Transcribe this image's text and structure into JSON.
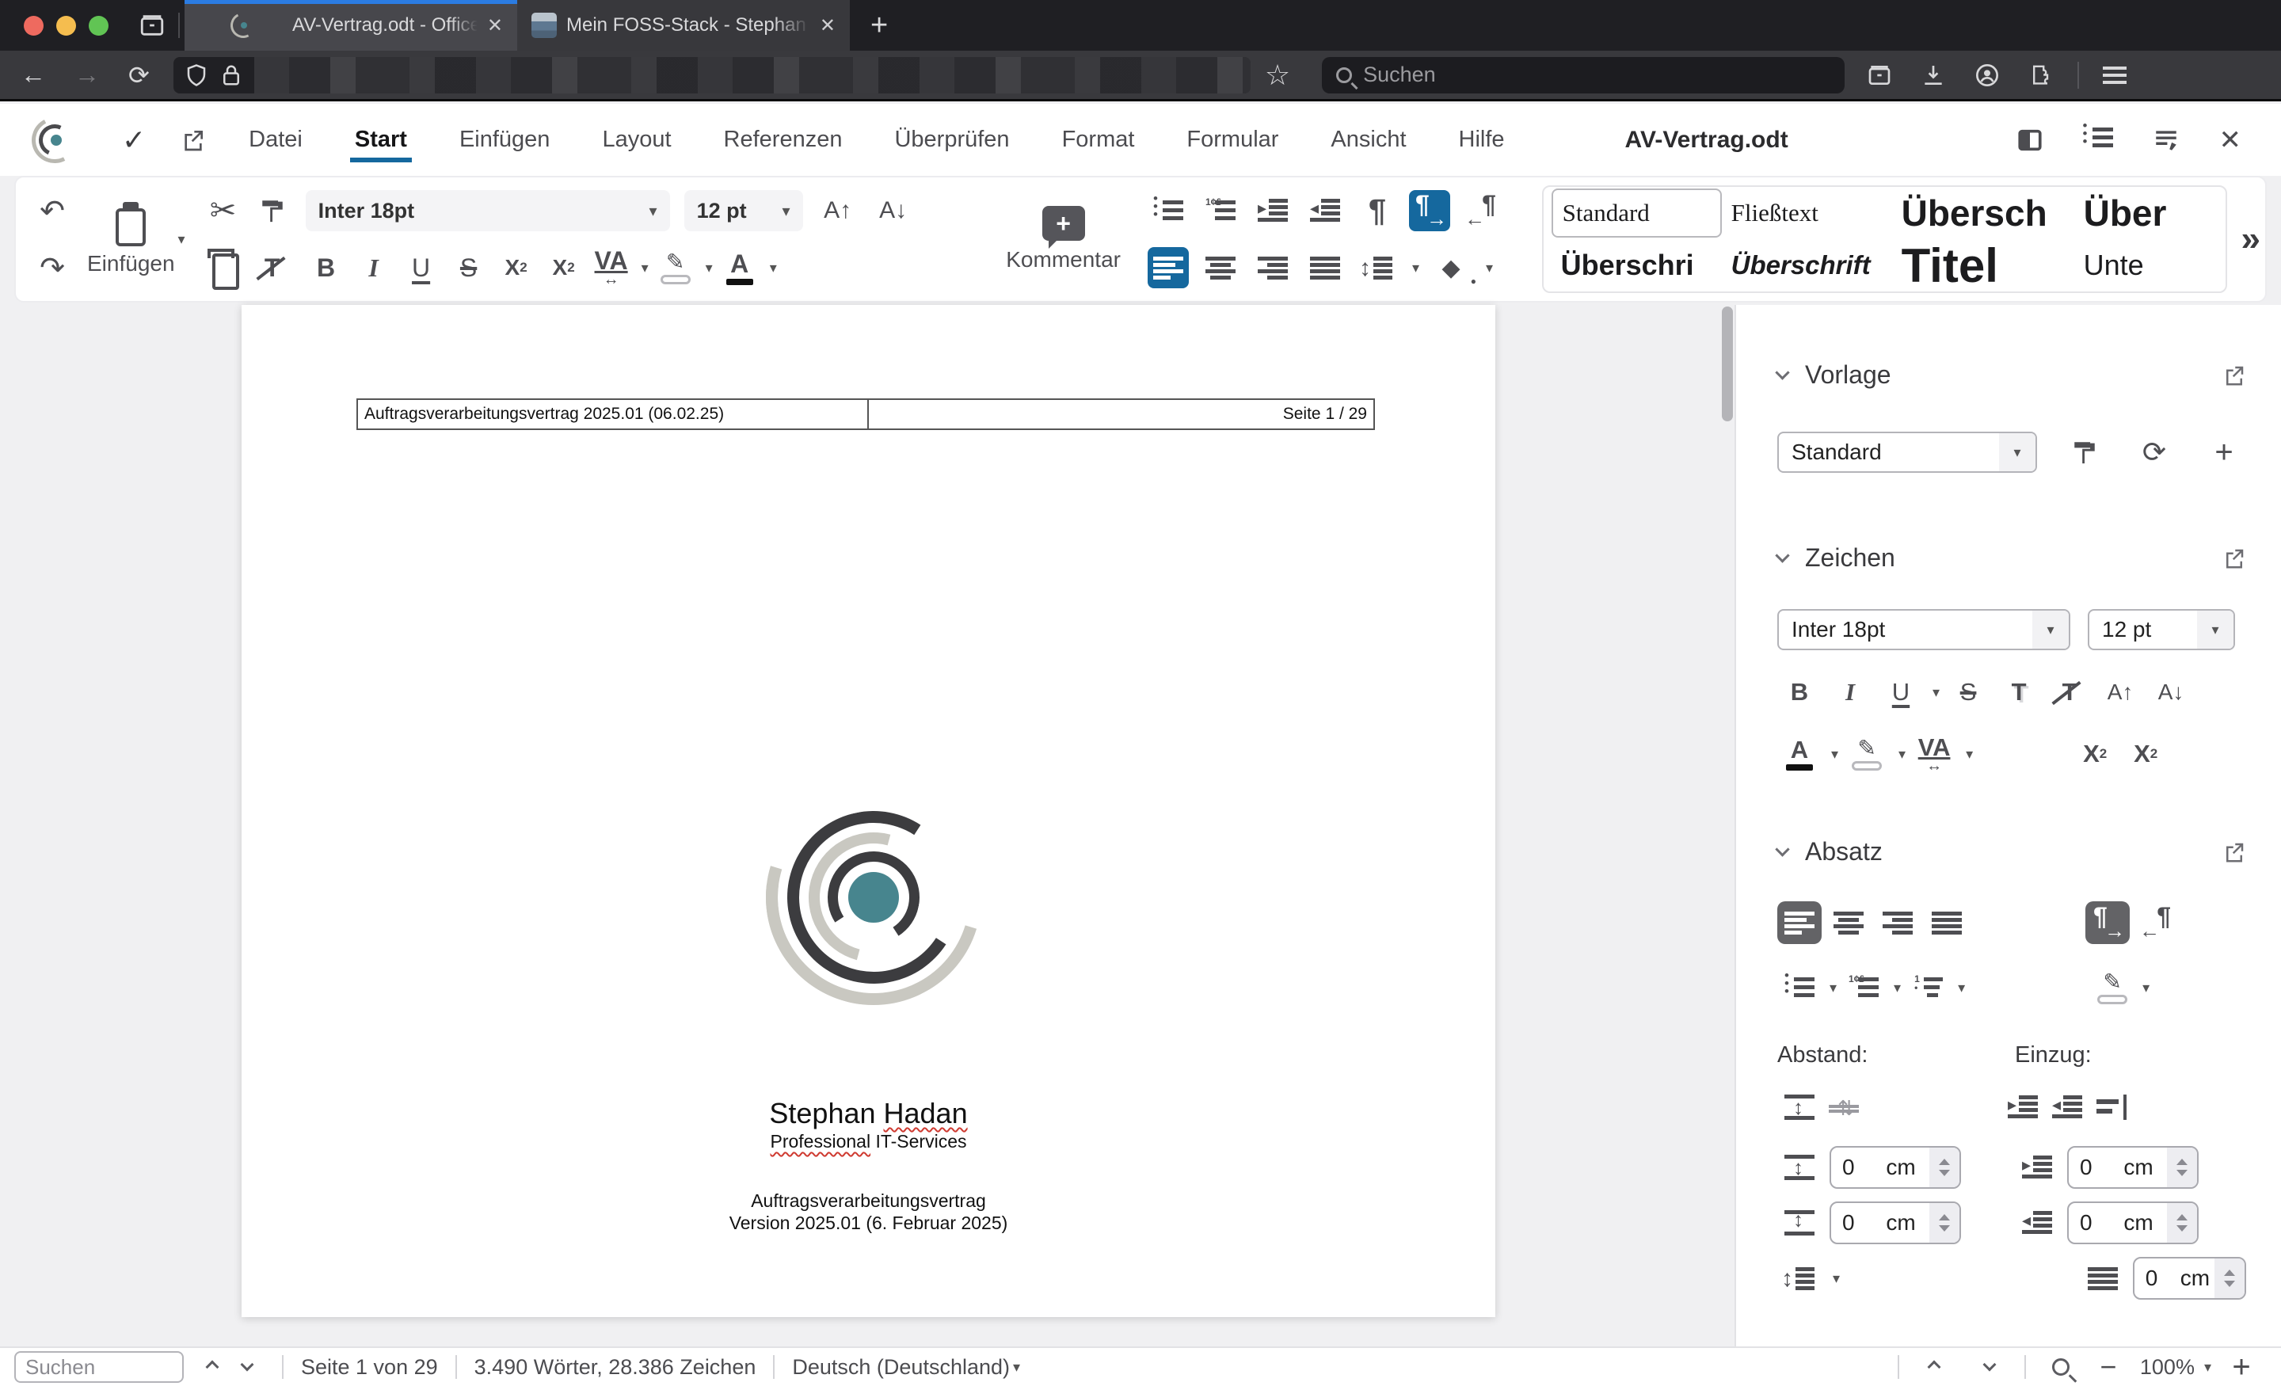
{
  "colors": {
    "accent_blue": "#15689e",
    "tab_indicator": "#2b7ce2",
    "teal": "#47858e",
    "arc_dark": "#3c3c3f",
    "arc_light": "#c9c8c1",
    "active_dark": "#636366"
  },
  "browser": {
    "tab1_title": "AV-Vertrag.odt - Office @ Hada",
    "tab2_title": "Mein FOSS-Stack - Stephan Ha",
    "close_glyph": "✕",
    "new_tab_glyph": "+",
    "back_glyph": "←",
    "forward_glyph": "→",
    "reload_glyph": "⟳",
    "star_glyph": "☆",
    "search_placeholder": "Suchen"
  },
  "menubar": {
    "check_glyph": "✓",
    "items": [
      "Datei",
      "Start",
      "Einfügen",
      "Layout",
      "Referenzen",
      "Überprüfen",
      "Format",
      "Formular",
      "Ansicht",
      "Hilfe"
    ],
    "doc_title": "AV-Vertrag.odt",
    "close_glyph": "✕"
  },
  "toolbar": {
    "undo_glyph": "↶",
    "redo_glyph": "↷",
    "paste_label": "Einfügen",
    "cut_glyph": "✂",
    "font_name": "Inter 18pt",
    "font_size": "12 pt",
    "grow_label": "A↑",
    "shrink_label": "A↓",
    "bold": "B",
    "italic": "I",
    "underline": "U",
    "strike": "S",
    "subscript": "X",
    "subscript_small": "2",
    "superscript": "X",
    "superscript_small": "2",
    "spacing_label": "VA",
    "spacing_arrow": "↔",
    "fontcolor_label": "A",
    "clearfmt_label": "T",
    "pen_glyph": "✎",
    "bucket_glyph": "◆",
    "comment_label": "Kommentar",
    "comment_plus": "+",
    "pilcrow": "¶",
    "ltr_arrow": "→",
    "rtl_arrow": "←",
    "styles": [
      "Standard",
      "Fließtext",
      "Übersch",
      "Über",
      "Überschri",
      "Überschrift",
      "Titel",
      "Unte"
    ],
    "styles_more_glyph": "»"
  },
  "sidebar": {
    "vorlage": {
      "title": "Vorlage",
      "value": "Standard",
      "sync_glyph": "⟳",
      "add_glyph": "+"
    },
    "zeichen": {
      "title": "Zeichen",
      "font_name": "Inter 18pt",
      "font_size": "12 pt",
      "bold": "B",
      "italic": "I",
      "underline": "U",
      "strike": "S",
      "shadow": "T",
      "clearfmt": "T",
      "grow": "A↑",
      "shrink": "A↓",
      "fontcolor": "A",
      "pen_glyph": "✎",
      "spacing": "VA",
      "spacing_arrow": "↔",
      "sup": "X",
      "sup_small": "2",
      "sub": "X",
      "sub_small": "2"
    },
    "absatz": {
      "title": "Absatz",
      "abstand_label": "Abstand:",
      "einzug_label": "Einzug:",
      "pilcrow": "¶",
      "ltr_arrow": "→",
      "rtl_arrow": "←",
      "pen_glyph": "✎",
      "abstand_fields": [
        {
          "value": "0",
          "unit": "cm"
        },
        {
          "value": "0",
          "unit": "cm"
        }
      ],
      "einzug_fields": [
        {
          "value": "0",
          "unit": "cm"
        },
        {
          "value": "0",
          "unit": "cm"
        },
        {
          "value": "0",
          "unit": "cm"
        }
      ]
    }
  },
  "document": {
    "header_left": "Auftragsverarbeitungsvertrag 2025.01 (06.02.25)",
    "header_right": "Seite 1 / 29",
    "name_first": "Stephan ",
    "name_last": "Hadan",
    "subtitle_first": "Professional",
    "subtitle_rest": " IT-Services",
    "line1": "Auftragsverarbeitungsvertrag",
    "line2": "Version 2025.01 (6. Februar 2025)"
  },
  "statusbar": {
    "search_placeholder": "Suchen",
    "page_info": "Seite 1 von 29",
    "word_count": "3.490 Wörter, 28.386 Zeichen",
    "language": "Deutsch (Deutschland)",
    "zoom_level": "100%",
    "minus_glyph": "−",
    "plus_glyph": "+"
  }
}
